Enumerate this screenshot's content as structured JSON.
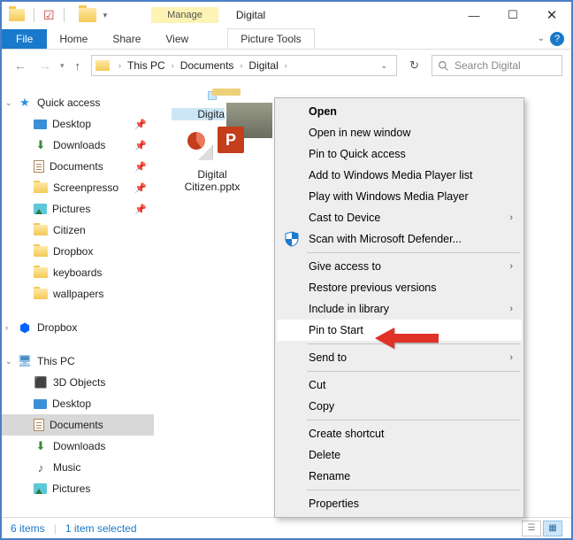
{
  "window": {
    "manage_label": "Manage",
    "title": "Digital",
    "tools_label": "Picture Tools"
  },
  "ribbon": {
    "file": "File",
    "home": "Home",
    "share": "Share",
    "view": "View"
  },
  "address": {
    "root": "This PC",
    "seg1": "Documents",
    "seg2": "Digital"
  },
  "search": {
    "placeholder": "Search Digital"
  },
  "nav": {
    "quick_access": "Quick access",
    "desktop": "Desktop",
    "downloads": "Downloads",
    "documents": "Documents",
    "screenpresso": "Screenpresso",
    "pictures": "Pictures",
    "citizen": "Citizen",
    "dropbox_folder": "Dropbox",
    "keyboards": "keyboards",
    "wallpapers": "wallpapers",
    "dropbox": "Dropbox",
    "this_pc": "This PC",
    "objects3d": "3D Objects",
    "desktop2": "Desktop",
    "documents2": "Documents",
    "downloads2": "Downloads",
    "music": "Music",
    "pictures2": "Pictures"
  },
  "files": {
    "folder_name": "Digital",
    "pptx_name": "Digital Citizen.pptx"
  },
  "ctx": {
    "open": "Open",
    "open_new": "Open in new window",
    "pin_quick": "Pin to Quick access",
    "add_wmp": "Add to Windows Media Player list",
    "play_wmp": "Play with Windows Media Player",
    "cast": "Cast to Device",
    "scan": "Scan with Microsoft Defender...",
    "give_access": "Give access to",
    "restore": "Restore previous versions",
    "include_lib": "Include in library",
    "pin_start": "Pin to Start",
    "send_to": "Send to",
    "cut": "Cut",
    "copy": "Copy",
    "create_shortcut": "Create shortcut",
    "delete": "Delete",
    "rename": "Rename",
    "properties": "Properties"
  },
  "status": {
    "count": "6 items",
    "selected": "1 item selected"
  }
}
